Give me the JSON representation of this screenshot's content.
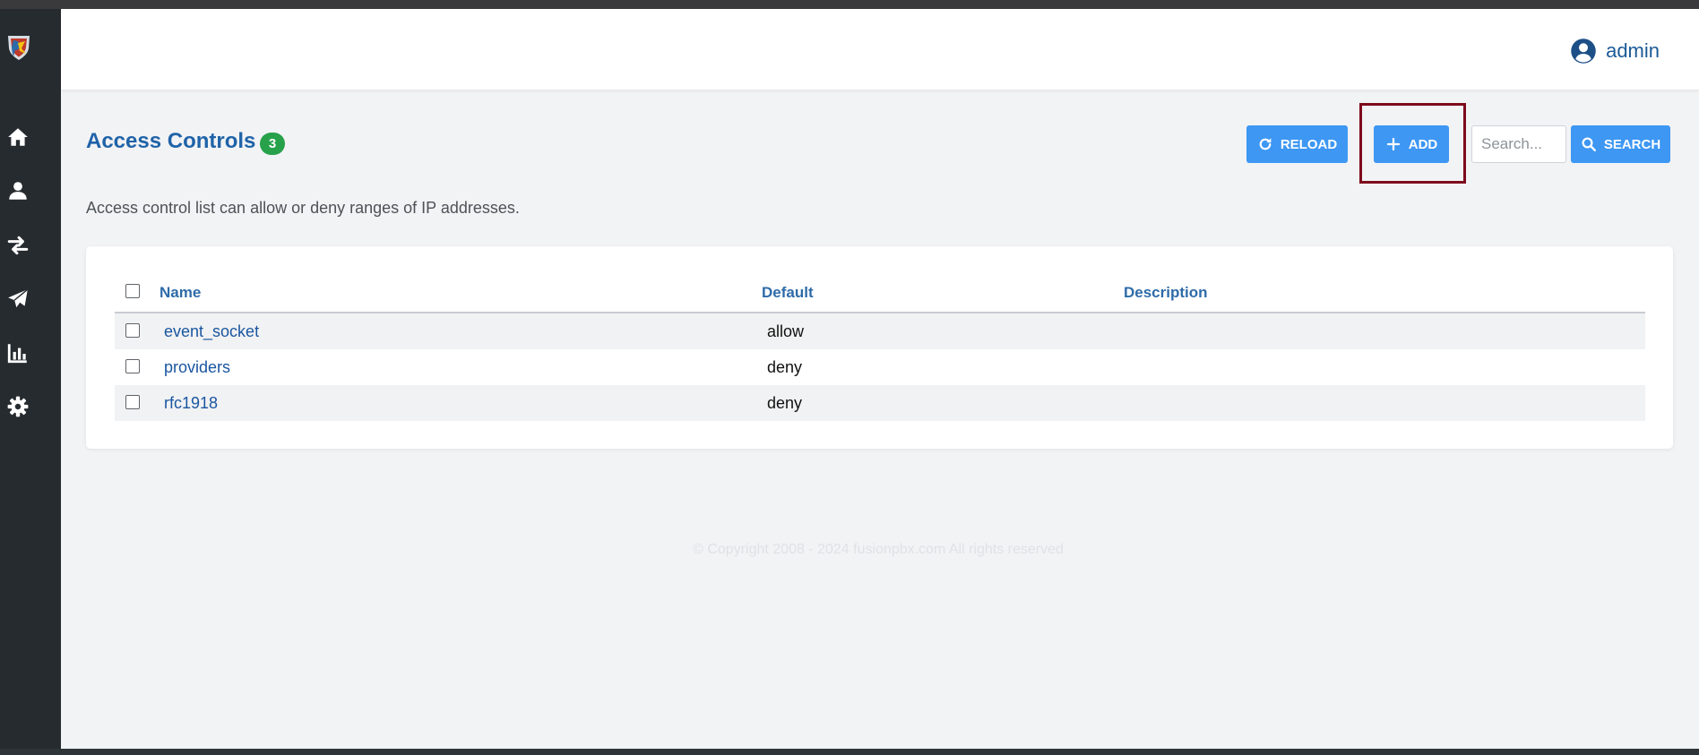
{
  "header": {
    "username": "admin"
  },
  "page": {
    "title": "Access Controls",
    "count": "3",
    "description": "Access control list can allow or deny ranges of IP addresses."
  },
  "toolbar": {
    "reload_label": "RELOAD",
    "add_label": "ADD",
    "search_placeholder": "Search...",
    "search_label": "SEARCH"
  },
  "sidebar": {
    "items": [
      {
        "icon": "home-icon"
      },
      {
        "icon": "user-icon"
      },
      {
        "icon": "exchange-arrows-icon"
      },
      {
        "icon": "paper-plane-icon"
      },
      {
        "icon": "bar-chart-icon"
      },
      {
        "icon": "gear-icon"
      }
    ]
  },
  "table": {
    "columns": [
      "Name",
      "Default",
      "Description"
    ],
    "rows": [
      {
        "name": "event_socket",
        "default": "allow",
        "description": ""
      },
      {
        "name": "providers",
        "default": "deny",
        "description": ""
      },
      {
        "name": "rfc1918",
        "default": "deny",
        "description": ""
      }
    ]
  },
  "footer": {
    "copyright": "© Copyright 2008 - 2024 fusionpbx.com All rights reserved"
  },
  "colors": {
    "sidebar_bg": "#262b30",
    "accent_blue": "#3d97f3",
    "title_blue": "#1f63a8",
    "badge_green": "#27a14a",
    "highlight": "#7d0a1c"
  }
}
